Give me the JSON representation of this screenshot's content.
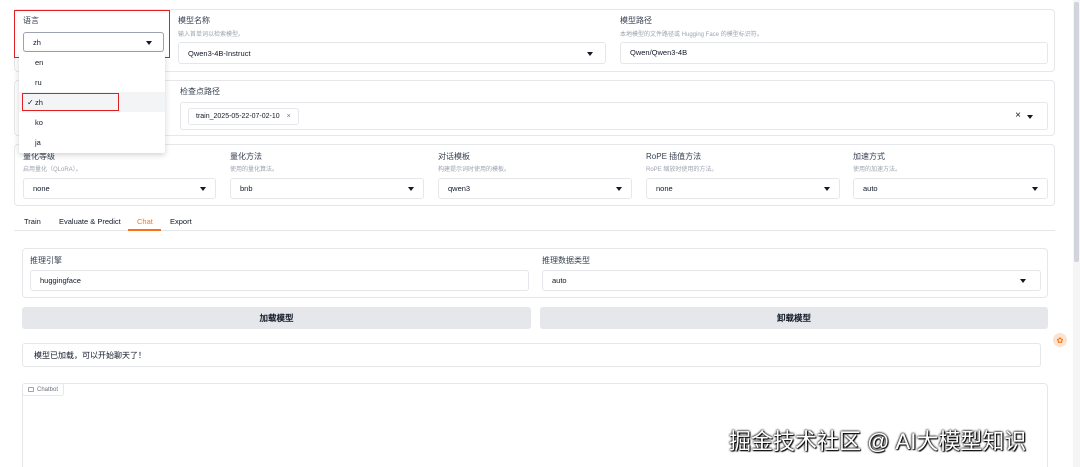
{
  "lang": {
    "label": "语言",
    "value": "zh",
    "options": [
      "en",
      "ru",
      "zh",
      "ko",
      "ja"
    ],
    "check": "✓"
  },
  "model_name": {
    "label": "模型名称",
    "hint": "输入首单词以检索模型。",
    "value": "Qwen3-4B-Instruct"
  },
  "model_path": {
    "label": "模型路径",
    "hint": "本地模型的文件路径或 Hugging Face 的模型标识符。",
    "value": "Qwen/Qwen3-4B"
  },
  "checkpoint": {
    "label": "检查点路径",
    "chip": "train_2025-05-22-07-02-10",
    "chip_close": "×",
    "clear": "×"
  },
  "quant_bit": {
    "label": "量化等级",
    "hint": "启用量化（QLoRA）。",
    "value": "none"
  },
  "quant_method": {
    "label": "量化方法",
    "hint": "使用的量化算法。",
    "value": "bnb"
  },
  "template": {
    "label": "对话模板",
    "hint": "构建提示词时使用的模板。",
    "value": "qwen3"
  },
  "rope": {
    "label": "RoPE 插值方法",
    "hint": "RoPE 缩放时使用的方法。",
    "value": "none"
  },
  "booster": {
    "label": "加速方式",
    "hint": "使用的加速方法。",
    "value": "auto"
  },
  "tabs": [
    "Train",
    "Evaluate & Predict",
    "Chat",
    "Export"
  ],
  "infer_backend": {
    "label": "推理引擎",
    "value": "huggingface"
  },
  "infer_dtype": {
    "label": "推理数据类型",
    "value": "auto"
  },
  "load_button": "加载模型",
  "unload_button": "卸载模型",
  "info_text": "模型已加载，可以开始聊天了！",
  "chatbot_label": "Chatbot",
  "watermark": "掘金技术社区 @ AI大模型知识",
  "colors": {
    "accent": "#f97316",
    "highlight": "#e02020",
    "button": "#e5e7eb"
  }
}
